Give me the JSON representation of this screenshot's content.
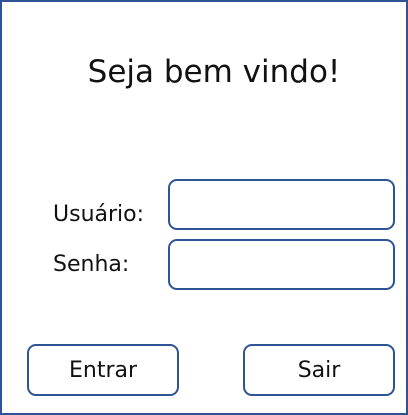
{
  "window": {
    "title": "Seja bem vindo!"
  },
  "form": {
    "username_label": "Usuário:",
    "username_value": "",
    "password_label": "Senha:",
    "password_value": ""
  },
  "actions": {
    "enter_label": "Entrar",
    "exit_label": "Sair"
  },
  "colors": {
    "border": "#2F5496",
    "background": "#FFFFFF",
    "text": "#111111"
  }
}
